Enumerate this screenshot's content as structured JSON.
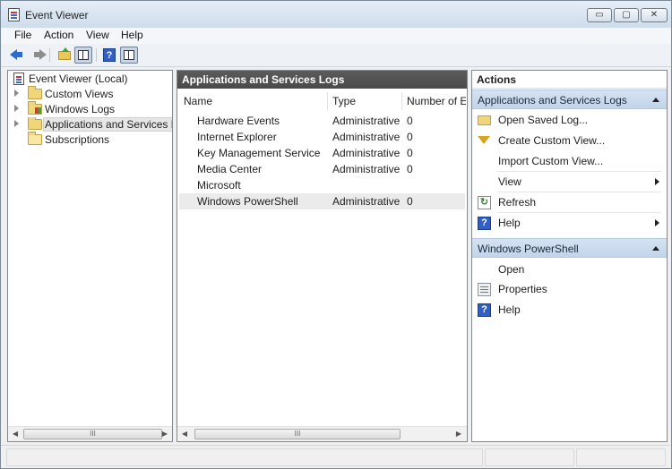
{
  "window": {
    "title": "Event Viewer"
  },
  "controls": {
    "minimize": "▭",
    "maximize": "▢",
    "close": "✕"
  },
  "menu": {
    "items": [
      "File",
      "Action",
      "View",
      "Help"
    ]
  },
  "toolbar": {
    "help_glyph": "?"
  },
  "tree": {
    "root": "Event Viewer (Local)",
    "items": [
      {
        "label": "Custom Views",
        "icon": "folder-icon",
        "expandable": true
      },
      {
        "label": "Windows Logs",
        "icon": "windows-logs-folder-icon",
        "expandable": true
      },
      {
        "label": "Applications and Services Lo",
        "icon": "folder-icon",
        "expandable": true,
        "selected": true
      },
      {
        "label": "Subscriptions",
        "icon": "subscriptions-folder-icon",
        "expandable": false
      }
    ]
  },
  "center": {
    "title": "Applications and Services Logs",
    "columns": [
      "Name",
      "Type",
      "Number of E"
    ],
    "rows": [
      {
        "name": "Hardware Events",
        "type": "Administrative",
        "count": "0"
      },
      {
        "name": "Internet Explorer",
        "type": "Administrative",
        "count": "0"
      },
      {
        "name": "Key Management Service",
        "type": "Administrative",
        "count": "0"
      },
      {
        "name": "Media Center",
        "type": "Administrative",
        "count": "0"
      },
      {
        "name": "Microsoft",
        "type": "",
        "count": ""
      },
      {
        "name": "Windows PowerShell",
        "type": "Administrative",
        "count": "0"
      }
    ]
  },
  "actions": {
    "title": "Actions",
    "section1": {
      "title": "Applications and Services Logs",
      "items": [
        {
          "label": "Open Saved Log...",
          "icon": "open-folder-icon"
        },
        {
          "label": "Create Custom View...",
          "icon": "filter-icon"
        },
        {
          "label": "Import Custom View...",
          "icon": ""
        },
        {
          "label": "View",
          "icon": "",
          "submenu": true
        },
        {
          "label": "Refresh",
          "icon": "refresh-icon"
        },
        {
          "label": "Help",
          "icon": "help-icon",
          "submenu": true
        }
      ]
    },
    "section2": {
      "title": "Windows PowerShell",
      "items": [
        {
          "label": "Open",
          "icon": ""
        },
        {
          "label": "Properties",
          "icon": "properties-icon"
        },
        {
          "label": "Help",
          "icon": "help-icon"
        }
      ]
    }
  },
  "scroll": {
    "left": "◀",
    "right": "▶",
    "thumb": "III"
  }
}
